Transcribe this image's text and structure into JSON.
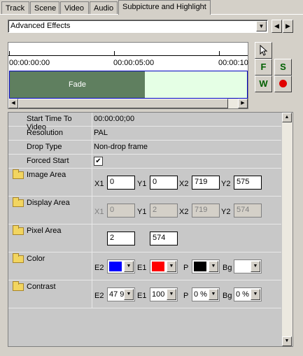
{
  "tabs": [
    {
      "label": "Track"
    },
    {
      "label": "Scene"
    },
    {
      "label": "Video"
    },
    {
      "label": "Audio"
    },
    {
      "label": "Subpicture and Highlight"
    }
  ],
  "effect_combo": {
    "value": "Advanced Effects"
  },
  "timeline": {
    "times": [
      "00:00:00:00",
      "00:00:05:00",
      "00:00:10"
    ],
    "clip_label": "Fade"
  },
  "tools": {
    "f": "F",
    "s": "S",
    "w": "W"
  },
  "properties": {
    "start_time": {
      "label": "Start Time To Video",
      "value": "00:00:00;00"
    },
    "resolution": {
      "label": "Resolution",
      "value": "PAL"
    },
    "drop_type": {
      "label": "Drop Type",
      "value": "Non-drop frame"
    },
    "forced_start": {
      "label": "Forced Start",
      "checked": "✔"
    },
    "image_area": {
      "label": "Image Area",
      "x1_label": "X1",
      "y1_label": "Y1",
      "x2_label": "X2",
      "y2_label": "Y2",
      "x1": "0",
      "y1": "0",
      "x2": "719",
      "y2": "575"
    },
    "display_area": {
      "label": "Display Area",
      "x1_label": "X1",
      "y1_label": "Y1",
      "x2_label": "X2",
      "y2_label": "Y2",
      "x1": "0",
      "y1": "2",
      "x2": "719",
      "y2": "574"
    },
    "pixel_area": {
      "label": "Pixel Area",
      "v1": "2",
      "v2": "574"
    },
    "color": {
      "label": "Color",
      "e2_label": "E2",
      "e1_label": "E1",
      "p_label": "P",
      "bg_label": "Bg",
      "e2_color": "#0000ff",
      "e1_color": "#ff0000",
      "p_color": "#000000",
      "bg_color": "#ffffff"
    },
    "contrast": {
      "label": "Contrast",
      "e2_label": "E2",
      "e1_label": "E1",
      "p_label": "P",
      "bg_label": "Bg",
      "e2": "47 9",
      "e1": "100",
      "p": "0 %",
      "bg": "0 %"
    }
  }
}
